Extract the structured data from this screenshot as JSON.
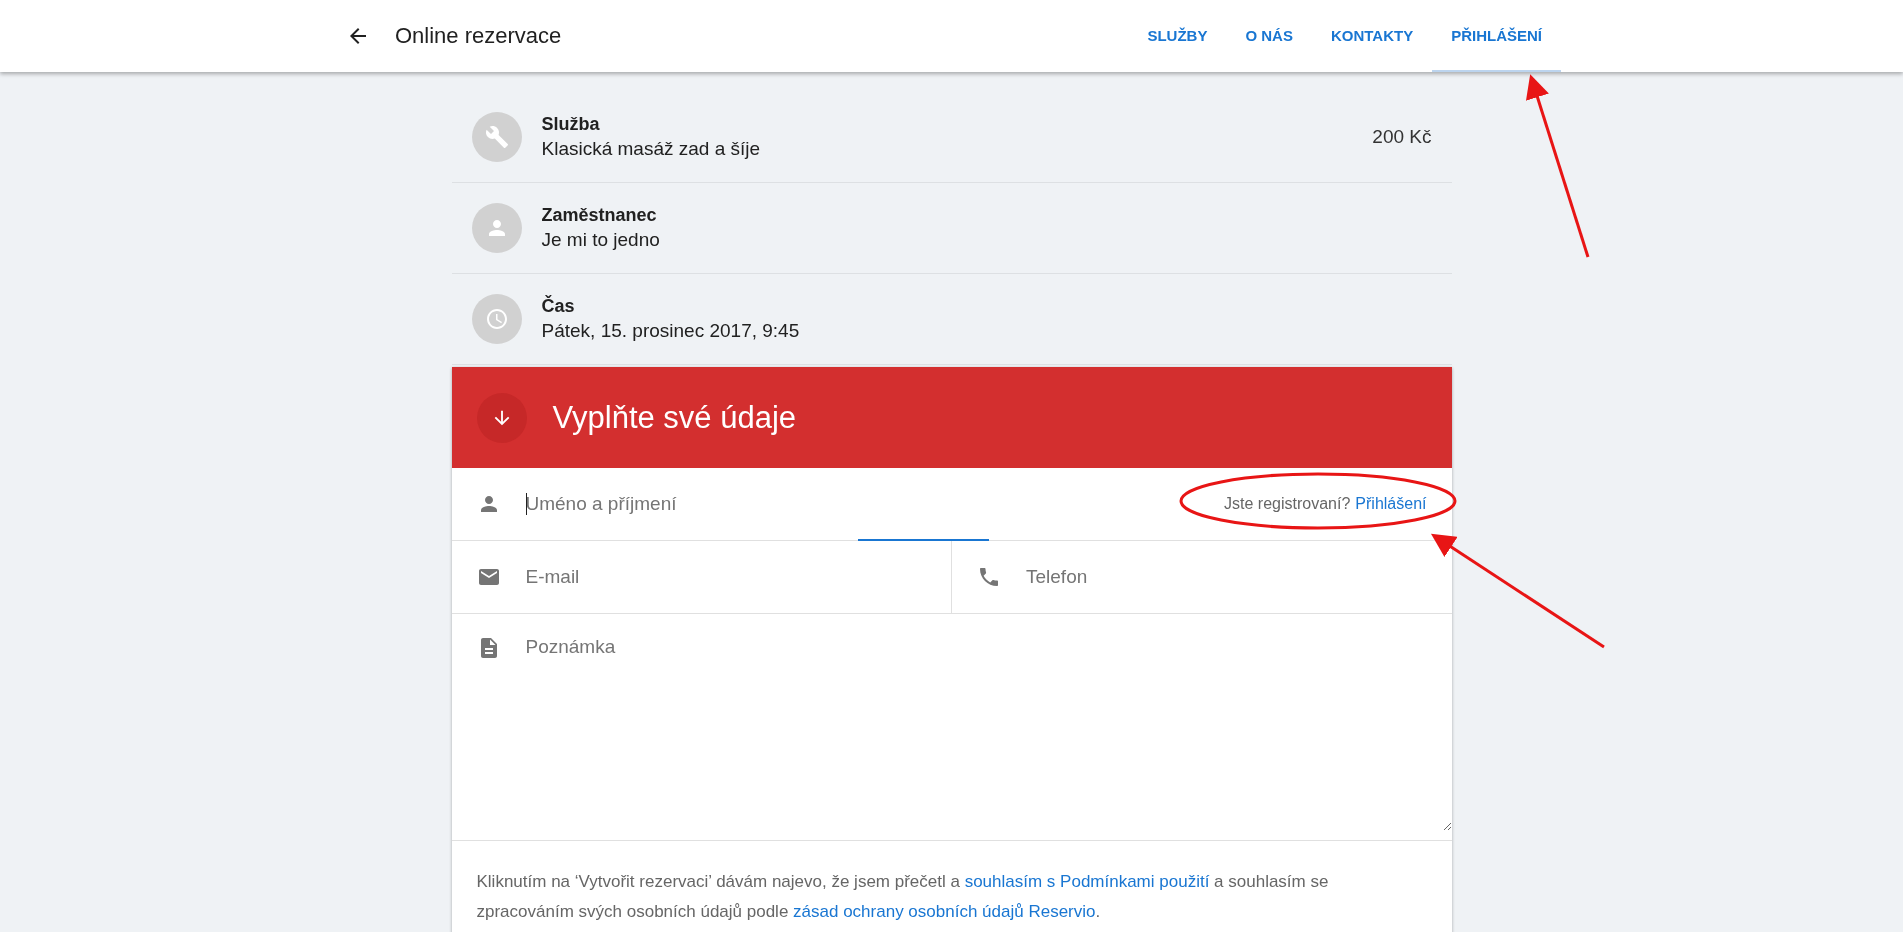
{
  "header": {
    "title": "Online rezervace",
    "nav": [
      {
        "label": "SLUŽBY",
        "selected": false
      },
      {
        "label": "O NÁS",
        "selected": false
      },
      {
        "label": "KONTAKTY",
        "selected": false
      },
      {
        "label": "PŘIHLÁŠENÍ",
        "selected": true
      }
    ]
  },
  "summary": [
    {
      "kind": "service",
      "label": "Služba",
      "value": "Klasická masáž zad a šíje",
      "price": "200 Kč"
    },
    {
      "kind": "employee",
      "label": "Zaměstnanec",
      "value": "Je mi to jedno"
    },
    {
      "kind": "time",
      "label": "Čas",
      "value": "Pátek, 15. prosinec 2017, 9:45"
    }
  ],
  "form": {
    "title": "Vyplňte své údaje",
    "name": {
      "placeholder": "Uméno a příjmení",
      "focused": true
    },
    "login_prompt": "Jste registrovaní?",
    "login_link": "Přihlášení",
    "email": {
      "placeholder": "E-mail"
    },
    "phone": {
      "placeholder": "Telefon"
    },
    "note": {
      "placeholder": "Poznámka"
    },
    "terms": [
      {
        "kind": "text",
        "text": "Kliknutím na ‘Vytvořit rezervaci’ dávám najevo, že jsem přečetl a "
      },
      {
        "kind": "link",
        "text": "souhlasím s Podmínkami použití"
      },
      {
        "kind": "text",
        "text": " a souhlasím se zpracováním svých osobních údajů podle "
      },
      {
        "kind": "link",
        "text": "zásad ochrany osobních údajů Reservio"
      },
      {
        "kind": "text",
        "text": "."
      }
    ]
  }
}
